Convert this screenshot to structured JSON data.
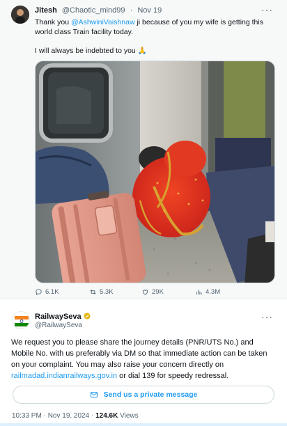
{
  "tweet": {
    "author_name": "Jitesh",
    "author_handle": "@Chaotic_mind99",
    "separator": "·",
    "date": "Nov 19",
    "text_prefix": "Thank you ",
    "mention": "@AshwiniVaishnaw",
    "text_suffix": " ji because of you my wife is getting this world class Train facility today.",
    "text_line2": "I will always be indebted to you",
    "emoji_icon": "folded-hands-emoji",
    "stats": {
      "replies": "6.1K",
      "reposts": "5.3K",
      "likes": "29K",
      "views": "4.3M"
    }
  },
  "reply": {
    "author_name": "RailwaySeva",
    "author_handle": "@RailwaySeva",
    "body_main": "We request you to please share the journey details (PNR/UTS No.) and Mobile No. with us preferably via DM so that immediate action can be taken on your complaint. You may also raise your concern directly on ",
    "link": "railmadad.indianrailways.gov.in",
    "body_tail": " or dial 139 for speedy redressal.",
    "dm_button_label": "Send us a private message",
    "timestamp": "10:33 PM · Nov 19, 2024 · ",
    "views_count": "124.6K",
    "views_label": " Views"
  },
  "colors": {
    "accent": "#1d9bf0",
    "text": "#0f1419",
    "muted": "#536471"
  },
  "icons": [
    "more-icon",
    "reply-icon",
    "repost-icon",
    "like-icon",
    "views-icon",
    "mail-icon",
    "verified-badge-icon"
  ]
}
